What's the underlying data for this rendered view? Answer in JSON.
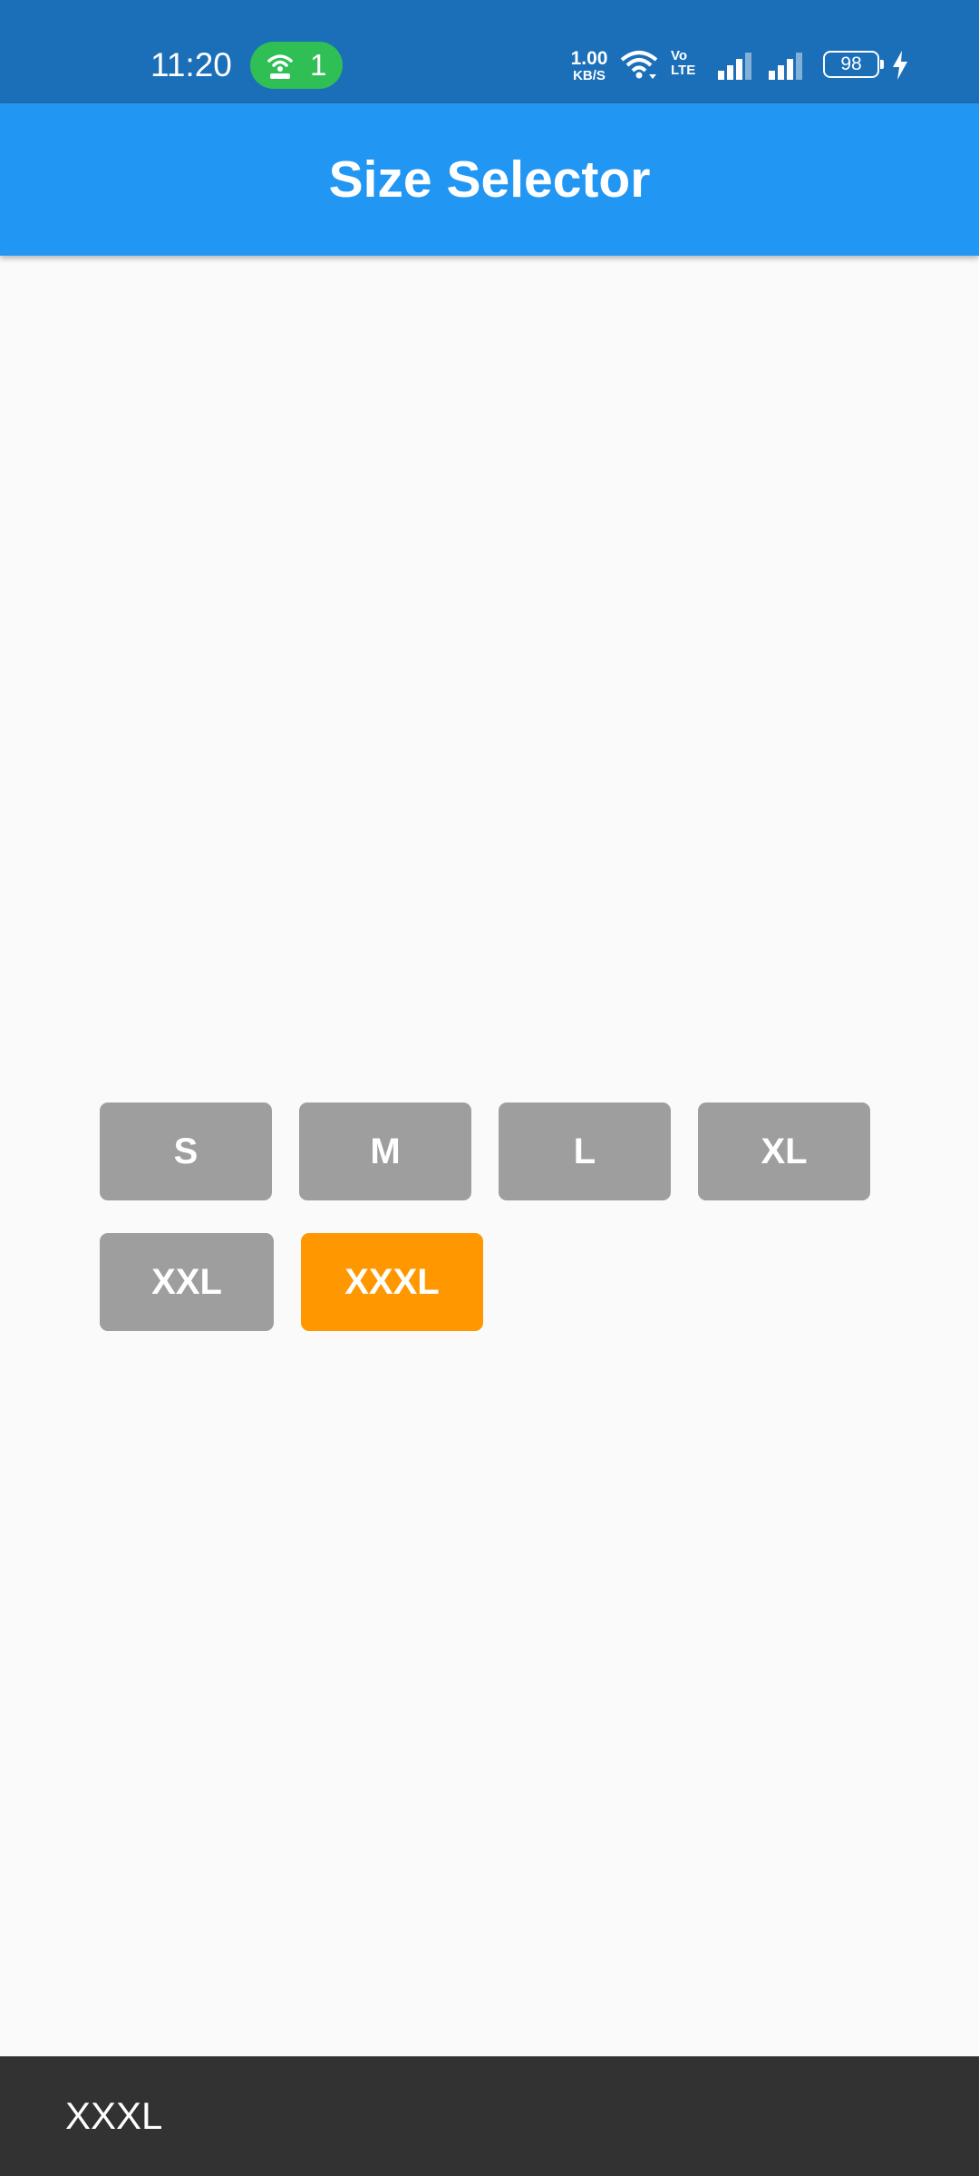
{
  "status_bar": {
    "time": "11:20",
    "hotspot_count": "1",
    "net_speed_value": "1.00",
    "net_speed_unit": "KB/S",
    "volte_top": "Vo",
    "volte_bottom": "LTE",
    "battery_level": "98",
    "icons": [
      "hotspot-icon",
      "wifi-icon",
      "volte-icon",
      "signal-icon",
      "signal-icon",
      "battery-icon",
      "charging-icon"
    ]
  },
  "app_bar": {
    "title": "Size Selector"
  },
  "sizes": {
    "row1": [
      "S",
      "M",
      "L",
      "XL"
    ],
    "row2": [
      "XXL",
      "XXXL"
    ],
    "selected": "XXXL"
  },
  "snackbar": {
    "message": "XXXL"
  },
  "colors": {
    "status_bar": "#1b6fb8",
    "app_bar": "#2196f3",
    "button_default": "#9e9e9e",
    "button_selected": "#ff9800",
    "snackbar": "#323232",
    "background": "#fafafa",
    "hotspot_pill": "#2fbf55"
  }
}
